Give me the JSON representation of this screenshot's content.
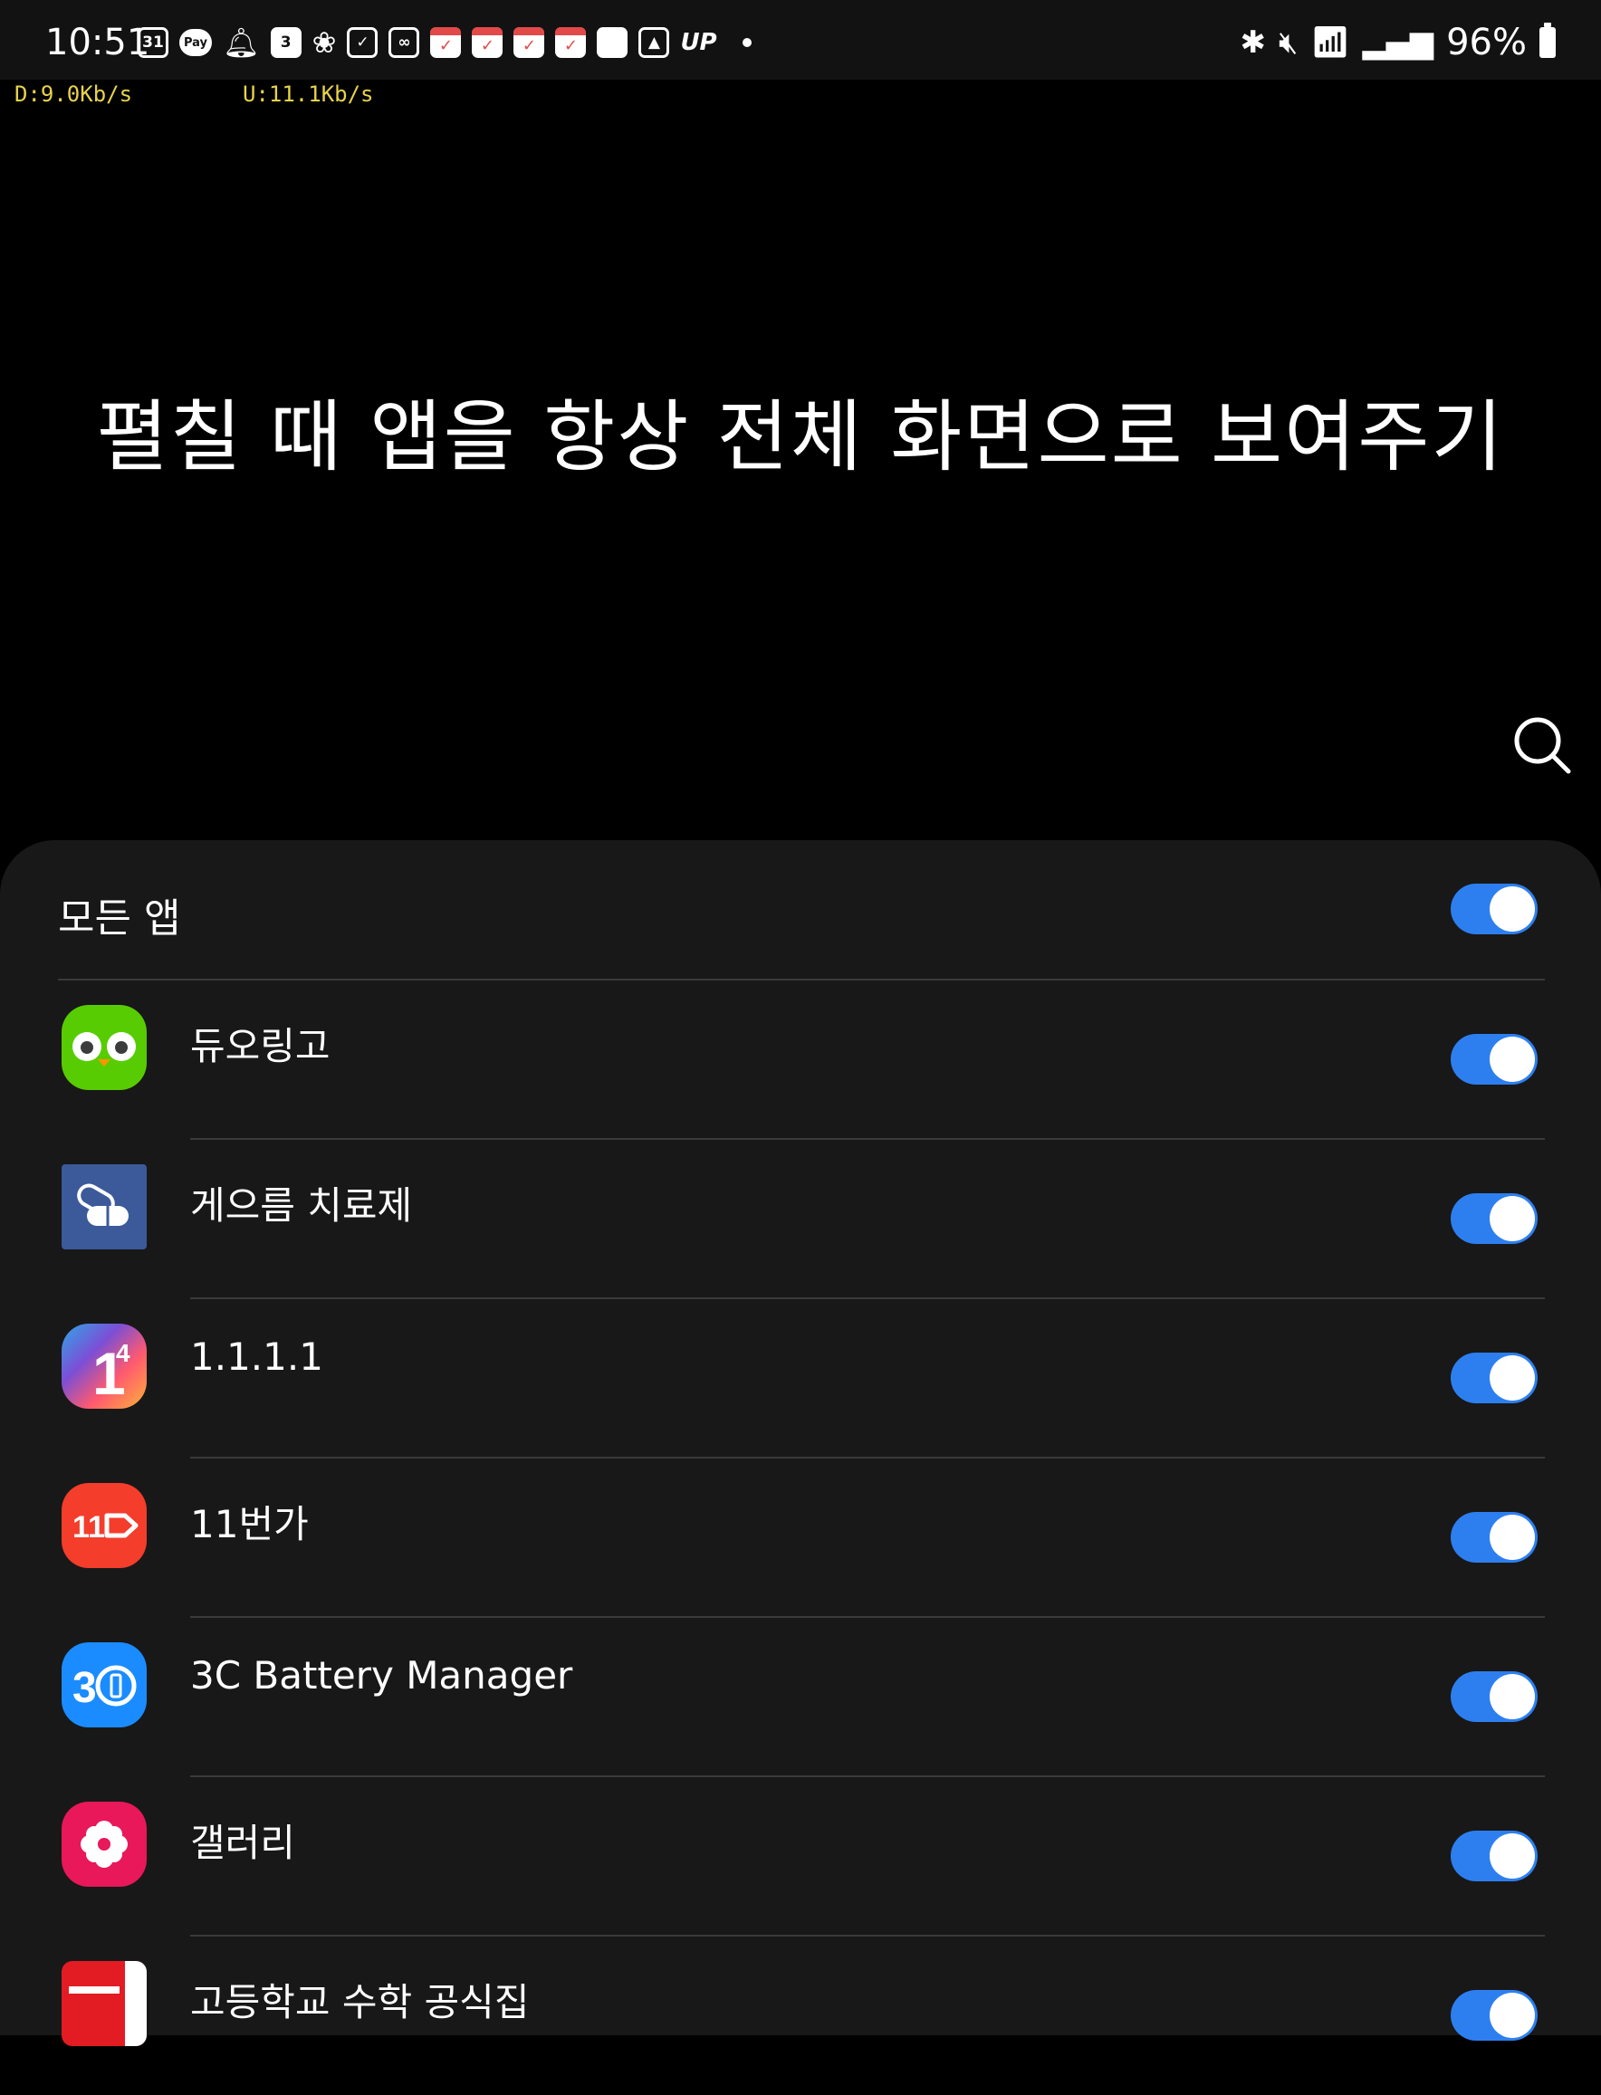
{
  "status_bar": {
    "time": "10:51",
    "calendar_day": "31",
    "pay_label": "Pay",
    "badge_number": "3",
    "up_label": "UP",
    "battery_percent": "96%",
    "download_speed": "D:9.0Kb/s",
    "upload_speed": "U:11.1Kb/s"
  },
  "header": {
    "title": "펼칠 때 앱을 항상 전체 화면으로 보여주기"
  },
  "all_apps": {
    "label": "모든 앱",
    "enabled": true
  },
  "apps": [
    {
      "name": "듀오링고",
      "icon": "duolingo-icon",
      "enabled": true
    },
    {
      "name": "게으름 치료제",
      "icon": "pill-icon",
      "enabled": true
    },
    {
      "name": "1.1.1.1",
      "icon": "cloudflare-1111-icon",
      "enabled": true
    },
    {
      "name": "11번가",
      "icon": "11st-icon",
      "enabled": true
    },
    {
      "name": "3C Battery Manager",
      "icon": "3c-battery-icon",
      "enabled": true
    },
    {
      "name": "갤러리",
      "icon": "gallery-flower-icon",
      "enabled": true
    },
    {
      "name": "고등학교 수학 공식집",
      "icon": "math-formula-book-icon",
      "enabled": true
    }
  ],
  "colors": {
    "toggle_on": "#2d7ff0",
    "panel_bg": "#181818",
    "netspeed": "#e8d34a"
  }
}
